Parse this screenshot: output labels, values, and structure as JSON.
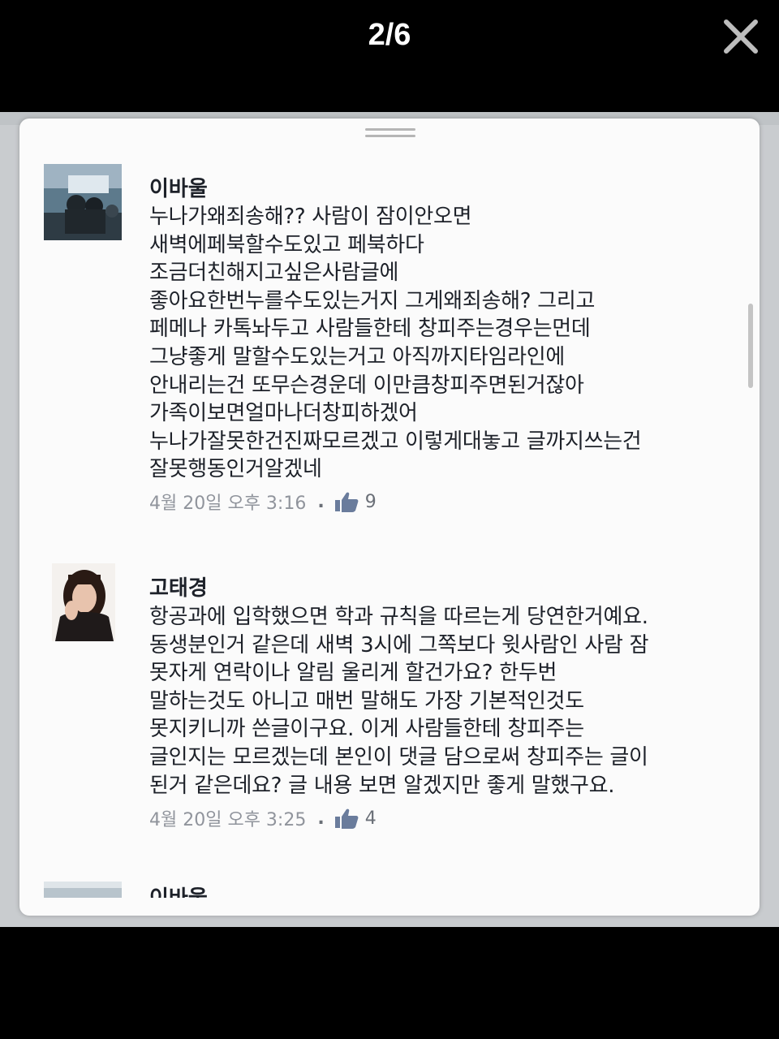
{
  "viewer": {
    "counter": "2/6",
    "close_icon": "close-icon"
  },
  "comments": [
    {
      "name": "이바울",
      "text": "누나가왜죄송해?? 사람이 잠이안오면\n새벽에페북할수도있고 페북하다\n조금더친해지고싶은사람글에\n좋아요한번누를수도있는거지 그게왜죄송해? 그리고\n페메나 카톡놔두고 사람들한테 창피주는경우는먼데\n그냥좋게 말할수도있는거고 아직까지타임라인에\n안내리는건 또무슨경운데 이만큼창피주면된거잖아\n가족이보면얼마나더창피하겠어\n누나가잘못한건진짜모르겠고 이렇게대놓고 글까지쓰는건\n잘못행동인거알겠네",
      "time": "4월 20일 오후 3:16",
      "likes": "9"
    },
    {
      "name": "고태경",
      "text": "항공과에 입학했으면 학과 규칙을 따르는게 당연한거예요.\n동생분인거 같은데 새벽 3시에 그쪽보다 윗사람인 사람 잠\n못자게 연락이나 알림 울리게 할건가요? 한두번\n말하는것도 아니고 매번 말해도 가장 기본적인것도\n못지키니까 쓴글이구요. 이게 사람들한테 창피주는\n글인지는 모르겠는데 본인이 댓글 담으로써 창피주는 글이\n된거 같은데요? 글 내용 보면 알겠지만 좋게 말했구요.",
      "time": "4월 20일 오후 3:25",
      "likes": "4"
    }
  ],
  "partial_comment": {
    "name": "이바울"
  },
  "colors": {
    "text": "#1d2129",
    "meta": "#90949c",
    "sheet": "#fbfbfb"
  }
}
